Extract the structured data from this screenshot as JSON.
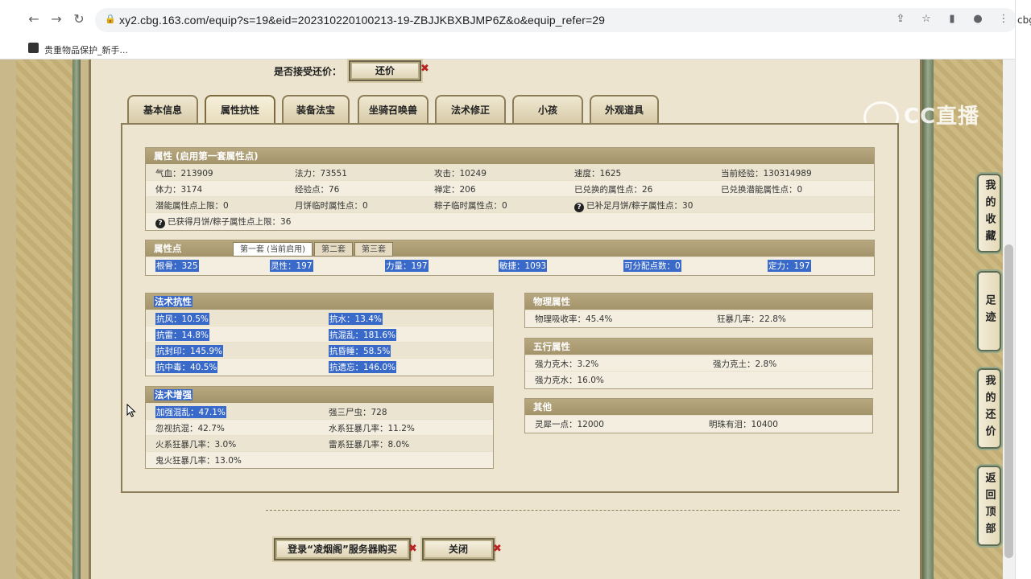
{
  "browser": {
    "url": "xy2.cbg.163.com/equip?s=19&eid=202310220100213-19-ZBJJKBXBJMP6Z&o&equip_refer=29",
    "bookmark_label": "贵重物品保护_新手...",
    "side_peek_text": "cbg"
  },
  "watermark": "CC直播",
  "offer": {
    "label": "是否接受还价：",
    "button": "还价"
  },
  "tabs": [
    "基本信息",
    "属性抗性",
    "装备法宝",
    "坐骑召唤兽",
    "法术修正",
    "小孩",
    "外观道具"
  ],
  "attributes": {
    "title": "属性 (启用第一套属性点)",
    "rows": [
      [
        "气血：213909",
        "法力：73551",
        "攻击：10249",
        "速度：1625",
        "当前经验：130314989"
      ],
      [
        "体力：3174",
        "经验点：76",
        "禅定：206",
        "已兑换的属性点：26",
        "已兑换潜能属性点：0"
      ],
      [
        "潜能属性点上限：0",
        "月饼临时属性点：0",
        "粽子临时属性点：0",
        "已补足月饼/粽子属性点：30",
        ""
      ],
      [
        "已获得月饼/粽子属性点上限：36"
      ]
    ]
  },
  "points": {
    "title": "属性点",
    "tabs": [
      "第一套 (当前启用)",
      "第二套",
      "第三套"
    ],
    "values": [
      "根骨：325",
      "灵性：197",
      "力量：197",
      "敏捷：1093",
      "可分配点数：0",
      "定力：197"
    ]
  },
  "resist": {
    "title": "法术抗性",
    "rows": [
      [
        "抗风：10.5%",
        "抗水：13.4%"
      ],
      [
        "抗雷：14.8%",
        "抗混乱：181.6%"
      ],
      [
        "抗封印：145.9%",
        "抗昏睡：58.5%"
      ],
      [
        "抗中毒：40.5%",
        "抗遗忘：146.0%"
      ]
    ]
  },
  "enhance": {
    "title": "法术增强",
    "rows": [
      [
        "加强混乱：47.1%",
        "强三尸虫：728"
      ],
      [
        "忽视抗混：42.7%",
        "水系狂暴几率：11.2%"
      ],
      [
        "火系狂暴几率：3.0%",
        "雷系狂暴几率：8.0%"
      ],
      [
        "鬼火狂暴几率：13.0%",
        ""
      ]
    ]
  },
  "physical": {
    "title": "物理属性",
    "rows": [
      [
        "物理吸收率：45.4%",
        "狂暴几率：22.8%"
      ]
    ]
  },
  "elements": {
    "title": "五行属性",
    "rows": [
      [
        "强力克木：3.2%",
        "强力克土：2.8%"
      ],
      [
        "强力克水：16.0%",
        ""
      ]
    ]
  },
  "other": {
    "title": "其他",
    "rows": [
      [
        "灵犀一点：12000",
        "明珠有泪：10400"
      ]
    ]
  },
  "footer": {
    "buy_button": "登录“凌烟阁”服务器购买",
    "close_button": "关闭"
  },
  "side_buttons": [
    "我的收藏",
    "足迹",
    "我的还价",
    "返回顶部"
  ]
}
